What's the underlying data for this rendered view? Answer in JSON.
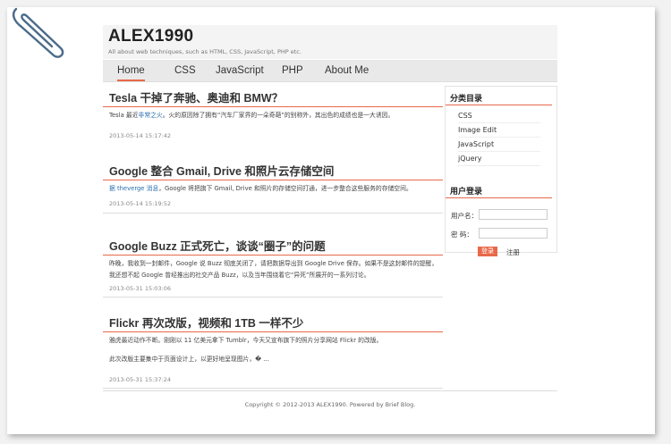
{
  "site": {
    "title": "ALEX1990",
    "tagline": "All about web techniques, such as HTML, CSS, JavaScript, PHP etc."
  },
  "nav": [
    "Home",
    "CSS",
    "JavaScript",
    "PHP",
    "About Me"
  ],
  "posts": [
    {
      "title": "Tesla 干掉了奔驰、奥迪和 BMW？",
      "body_pre": "Tesla 最近",
      "body_link": "非常之火",
      "body_post": "。火的原因除了拥有“汽车厂家界的一朵奇葩”的别称外，其出色的成绩也是一大诱因。",
      "date": "2013-05-14 15:17:42"
    },
    {
      "title": "Google 整合 Gmail, Drive 和照片云存储空间",
      "body_pre": "",
      "body_link": "据 theverge 消息",
      "body_post": "，Google 将把旗下 Gmail, Drive 和照片的存储空间打通，进一步整合这些服务的存储空间。",
      "date": "2013-05-14 15:19:52"
    },
    {
      "title": "Google Buzz 正式死亡，谈谈“圈子”的问题",
      "body": "昨晚，我收到一封邮件，Google 说 Buzz 彻底关闭了，请把数据导出到 Google Drive 保存。如果不是这封邮件的提醒，我还想不起 Google 曾经推出的社交产品 Buzz，以及当年围绕着它“异死”所展开的一系列讨论。",
      "date": "2013-05-31 15:03:06"
    },
    {
      "title": "Flickr 再次改版，视频和 1TB 一样不少",
      "body": "雅虎最近动作不断。刚刚以 11 亿美元拿下 Tumblr，今天又宣布旗下的照片分享网站 Flickr 的改版。",
      "body2": "此次改版主要集中于页面设计上，以更好地呈现图片，� ...",
      "date": "2013-05-31 15:37:24"
    }
  ],
  "sidebar": {
    "categories_title": "分类目录",
    "categories": [
      "CSS",
      "Image Edit",
      "JavaScript",
      "jQuery"
    ],
    "login_title": "用户登录",
    "username_label": "用户名：",
    "password_label": "密    码：",
    "login_button": "登录",
    "register_link": "注册"
  },
  "footer": "Copyright © 2012-2013 ALEX1990. Powered by Brief Blog.",
  "colors": {
    "accent": "#e8694a",
    "link": "#2a6fb0"
  },
  "icons": [
    "paperclip-icon"
  ]
}
